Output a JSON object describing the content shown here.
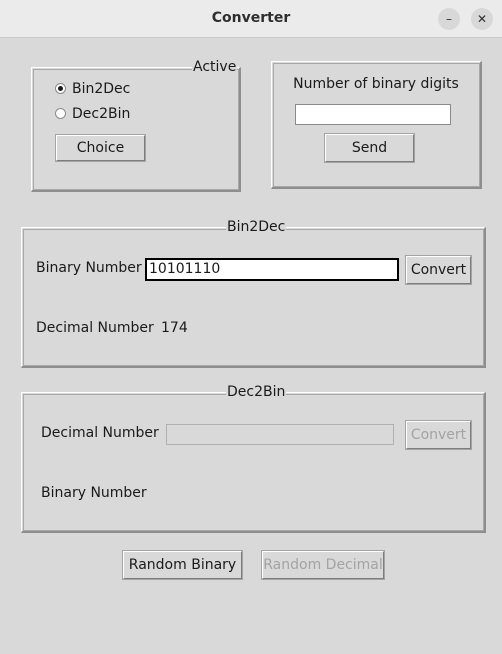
{
  "window": {
    "title": "Converter",
    "minimize_glyph": "–",
    "close_glyph": "✕"
  },
  "active": {
    "legend": "Active",
    "options": [
      {
        "label": "Bin2Dec",
        "selected": true
      },
      {
        "label": "Dec2Bin",
        "selected": false
      }
    ],
    "choice_label": "Choice"
  },
  "digits": {
    "label": "Number of binary digits",
    "value": "",
    "send_label": "Send"
  },
  "bin2dec": {
    "legend": "Bin2Dec",
    "binary_label": "Binary Number",
    "binary_value": "10101110",
    "convert_label": "Convert",
    "decimal_label": "Decimal Number",
    "decimal_value": "174"
  },
  "dec2bin": {
    "legend": "Dec2Bin",
    "decimal_label": "Decimal Number",
    "decimal_value": "",
    "convert_label": "Convert",
    "binary_label": "Binary Number",
    "binary_value": ""
  },
  "footer": {
    "random_binary_label": "Random Binary",
    "random_decimal_label": "Random Decimal"
  }
}
